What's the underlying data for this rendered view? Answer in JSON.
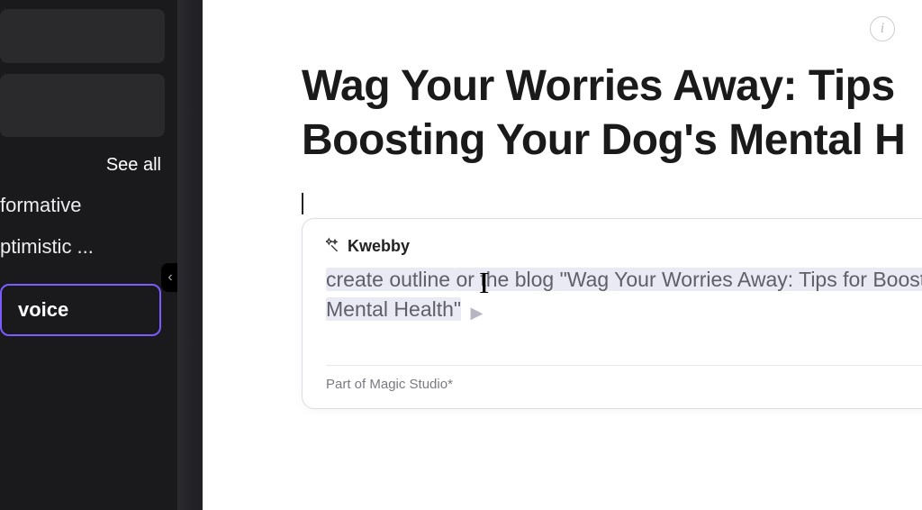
{
  "sidebar": {
    "see_all": "See all",
    "tones": [
      "formative",
      "ptimistic ..."
    ],
    "voice_btn": "voice"
  },
  "main": {
    "title_line1": "Wag Your Worries Away: Tips",
    "title_line2": "Boosting Your Dog's Mental H",
    "info_icon": "i"
  },
  "ai": {
    "label": "Kwebby",
    "input_line1a": "create outline ",
    "input_line1b": "or the blog \"Wag Your Worries Away: Tips for Boosting",
    "input_line2": "Mental Health\"",
    "footer": "Part of Magic Studio*",
    "ibeam_glyph": "I"
  }
}
